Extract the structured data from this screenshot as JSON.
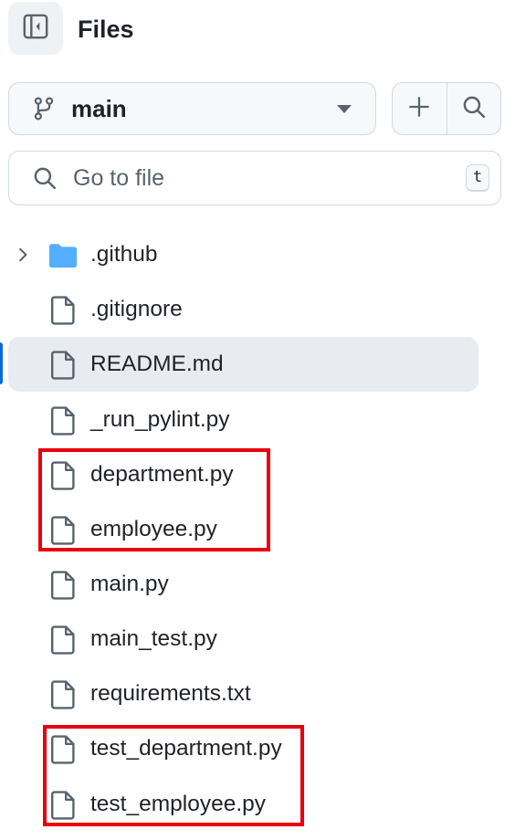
{
  "header": {
    "title": "Files",
    "collapse_icon": "sidebar-collapse-icon"
  },
  "branch": {
    "label": "main",
    "icon": "git-branch-icon"
  },
  "actions": {
    "add_icon": "plus-icon",
    "search_icon": "search-icon"
  },
  "search": {
    "placeholder": "Go to file",
    "shortcut": "t"
  },
  "tree": {
    "items": [
      {
        "name": ".github",
        "type": "folder",
        "expandable": true
      },
      {
        "name": ".gitignore",
        "type": "file"
      },
      {
        "name": "README.md",
        "type": "file",
        "selected": true
      },
      {
        "name": "_run_pylint.py",
        "type": "file"
      },
      {
        "name": "department.py",
        "type": "file",
        "highlighted": true
      },
      {
        "name": "employee.py",
        "type": "file",
        "highlighted": true
      },
      {
        "name": "main.py",
        "type": "file"
      },
      {
        "name": "main_test.py",
        "type": "file"
      },
      {
        "name": "requirements.txt",
        "type": "file"
      },
      {
        "name": "test_department.py",
        "type": "file",
        "highlighted": true
      },
      {
        "name": "test_employee.py",
        "type": "file",
        "highlighted": true
      }
    ]
  },
  "colors": {
    "highlight_border": "#e8000b",
    "folder": "#54aeff",
    "active_marker": "#0969da",
    "selected_row": "#e8ebef"
  }
}
